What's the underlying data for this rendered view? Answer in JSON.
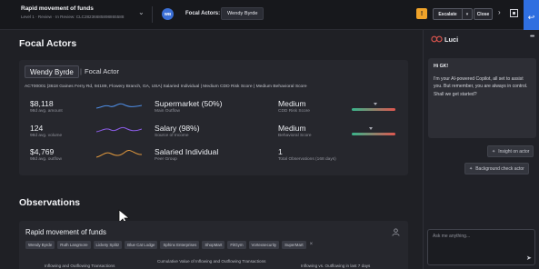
{
  "header": {
    "case_title": "Rapid movement of funds",
    "case_subtitle": "Level 1 · Review · In Review: CLC28236685898865588",
    "avatar_initials": "WB",
    "focal_actors_label": "Focal Actors:",
    "focal_actor_name": "Wendy Byrde",
    "warning_glyph": "!",
    "escalate_label": "Escalate",
    "close_label": "Close"
  },
  "focal_actors": {
    "section_title": "Focal Actors",
    "name": "Wendy Byrde",
    "role": "Focal Actor",
    "detail": "ACT00001 |3618 Gaines Ferry Rd, 94189, Flowery Branch, GA, USA| Salaried Individual | Medium CDD Risk Score | Medium Behavioral Score",
    "metrics": [
      {
        "value": "$8,118",
        "label": "98d avg. amount"
      },
      {
        "value": "124",
        "label": "98d avg. volume"
      },
      {
        "value": "$4,769",
        "label": "98d avg. outflow"
      }
    ],
    "sparkline_colors": [
      "#4f8fe8",
      "#8b5ce6",
      "#e39a3e"
    ],
    "attributes": [
      {
        "value": "Supermarket (50%)",
        "label": "Main Outflow"
      },
      {
        "value": "Salary (98%)",
        "label": "Source of Income"
      },
      {
        "value": "Salaried Individual",
        "label": "Peer Group"
      }
    ],
    "scores": [
      {
        "value": "Medium",
        "label": "CDD Risk Score",
        "level": 0.55
      },
      {
        "value": "Medium",
        "label": "Behavioral Score",
        "level": 0.45
      }
    ],
    "observations_count": {
      "value": "1",
      "label": "Total Observations (168 days)"
    }
  },
  "observations": {
    "section_title": "Observations",
    "card_title": "Rapid movement of funds",
    "tags": [
      "Wendy Byrde",
      "Ruth Langmore",
      "Lickety Splitz",
      "Blue Cat Lodge",
      "Sphinx Enterprises",
      "ShopMart",
      "FitGym",
      "Vortexsecurity",
      "SuperMart"
    ],
    "chart_captions": [
      "Inflowing and Outflowing Transactions",
      "Cumulative Value of Inflowing and Outflowing Transactions",
      "Inflowing vs. Outflowing in last 7 days"
    ]
  },
  "assistant": {
    "name": "Luci",
    "greeting": "Hi GK!",
    "message": "I'm your AI-powered Copilot, all set to assist you. But remember, you are always in control. Shall we get started?",
    "chips": [
      "Insight on actor",
      "Background check actor"
    ],
    "input_placeholder": "Ask me anything..."
  },
  "colors": {
    "accent_blue": "#2f6fe0",
    "warning": "#f0a32a",
    "score_low": "#38b48b",
    "score_high": "#e0564f"
  }
}
